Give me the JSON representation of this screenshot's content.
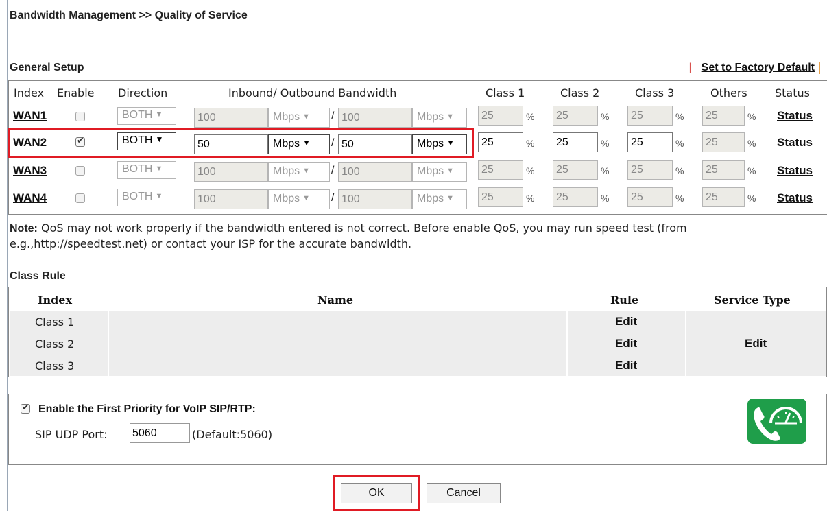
{
  "page": {
    "title": "Bandwidth Management >> Quality of Service"
  },
  "general": {
    "heading": "General Setup",
    "factory_default": "Set to Factory Default",
    "headers": {
      "index": "Index",
      "enable": "Enable",
      "direction": "Direction",
      "bandwidth": "Inbound/ Outbound Bandwidth",
      "class1": "Class 1",
      "class2": "Class 2",
      "class3": "Class 3",
      "others": "Others",
      "status": "Status"
    },
    "rows": [
      {
        "index": "WAN1",
        "enabled": false,
        "direction": "BOTH",
        "inbound": "100",
        "inbound_unit": "Mbps",
        "outbound": "100",
        "outbound_unit": "Mbps",
        "class1": "25",
        "class2": "25",
        "class3": "25",
        "others": "25",
        "pct": "%",
        "slash": "/",
        "status": "Status"
      },
      {
        "index": "WAN2",
        "enabled": true,
        "direction": "BOTH",
        "inbound": "50",
        "inbound_unit": "Mbps",
        "outbound": "50",
        "outbound_unit": "Mbps",
        "class1": "25",
        "class2": "25",
        "class3": "25",
        "others": "25",
        "pct": "%",
        "slash": "/",
        "status": "Status"
      },
      {
        "index": "WAN3",
        "enabled": false,
        "direction": "BOTH",
        "inbound": "100",
        "inbound_unit": "Mbps",
        "outbound": "100",
        "outbound_unit": "Mbps",
        "class1": "25",
        "class2": "25",
        "class3": "25",
        "others": "25",
        "pct": "%",
        "slash": "/",
        "status": "Status"
      },
      {
        "index": "WAN4",
        "enabled": false,
        "direction": "BOTH",
        "inbound": "100",
        "inbound_unit": "Mbps",
        "outbound": "100",
        "outbound_unit": "Mbps",
        "class1": "25",
        "class2": "25",
        "class3": "25",
        "others": "25",
        "pct": "%",
        "slash": "/",
        "status": "Status"
      }
    ]
  },
  "note": {
    "label": "Note:",
    "text": " QoS may not work properly if the bandwidth entered is not correct. Before enable QoS, you may run speed test (from e.g.,http://speedtest.net) or contact your ISP for the accurate bandwidth."
  },
  "class_rule": {
    "heading": "Class Rule",
    "headers": {
      "index": "Index",
      "name": "Name",
      "rule": "Rule",
      "service_type": "Service Type"
    },
    "rows": [
      {
        "index": "Class 1",
        "name": "",
        "rule": "Edit"
      },
      {
        "index": "Class 2",
        "name": "",
        "rule": "Edit"
      },
      {
        "index": "Class 3",
        "name": "",
        "rule": "Edit"
      }
    ],
    "service_edit": "Edit"
  },
  "voip": {
    "enabled": true,
    "label": "Enable the First Priority for VoIP SIP/RTP:",
    "port_label": "SIP UDP Port:",
    "port_value": "5060",
    "port_default": "(Default:5060)",
    "icon": "phone-gauge-icon",
    "icon_color": "#1f9e4a"
  },
  "buttons": {
    "ok": "OK",
    "cancel": "Cancel"
  },
  "colors": {
    "highlight": "#e01b24",
    "disabled_field": "#ecebe6"
  }
}
